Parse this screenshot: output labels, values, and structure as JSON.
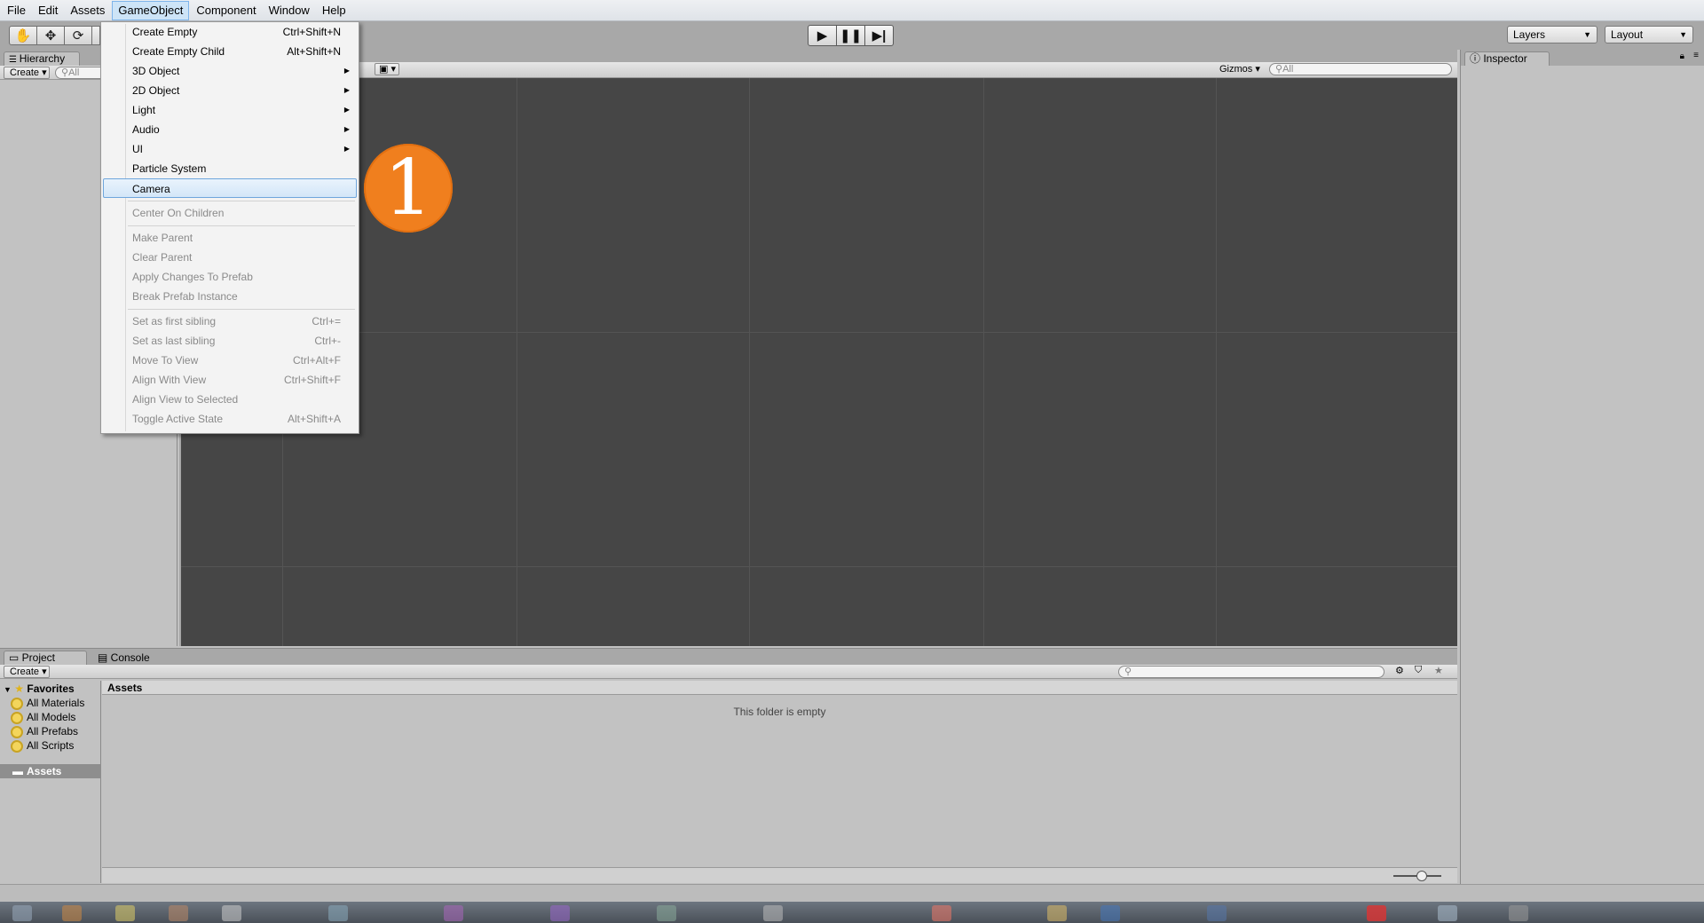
{
  "menubar": {
    "items": [
      "File",
      "Edit",
      "Assets",
      "GameObject",
      "Component",
      "Window",
      "Help"
    ],
    "active": "GameObject"
  },
  "toolbar": {
    "layers_label": "Layers",
    "layout_label": "Layout"
  },
  "hierarchy": {
    "tab_label": "Hierarchy",
    "create_label": "Create",
    "search_placeholder": "All"
  },
  "scene": {
    "gizmos_label": "Gizmos",
    "search_placeholder": "All"
  },
  "inspector": {
    "tab_label": "Inspector"
  },
  "project": {
    "tab_project": "Project",
    "tab_console": "Console",
    "create_label": "Create",
    "favorites_title": "Favorites",
    "favorites": [
      "All Materials",
      "All Models",
      "All Prefabs",
      "All Scripts"
    ],
    "assets_item": "Assets",
    "header": "Assets",
    "empty_message": "This folder is empty"
  },
  "gameobject_menu": {
    "items": [
      {
        "label": "Create Empty",
        "shortcut": "Ctrl+Shift+N"
      },
      {
        "label": "Create Empty Child",
        "shortcut": "Alt+Shift+N"
      },
      {
        "label": "3D Object",
        "submenu": true
      },
      {
        "label": "2D Object",
        "submenu": true
      },
      {
        "label": "Light",
        "submenu": true
      },
      {
        "label": "Audio",
        "submenu": true
      },
      {
        "label": "UI",
        "submenu": true
      },
      {
        "label": "Particle System"
      },
      {
        "label": "Camera",
        "highlighted": true
      },
      {
        "label": "Center On Children",
        "disabled": true
      },
      {
        "label": "Make Parent",
        "disabled": true
      },
      {
        "label": "Clear Parent",
        "disabled": true
      },
      {
        "label": "Apply Changes To Prefab",
        "disabled": true
      },
      {
        "label": "Break Prefab Instance",
        "disabled": true
      },
      {
        "label": "Set as first sibling",
        "shortcut": "Ctrl+=",
        "disabled": true
      },
      {
        "label": "Set as last sibling",
        "shortcut": "Ctrl+-",
        "disabled": true
      },
      {
        "label": "Move To View",
        "shortcut": "Ctrl+Alt+F",
        "disabled": true
      },
      {
        "label": "Align With View",
        "shortcut": "Ctrl+Shift+F",
        "disabled": true
      },
      {
        "label": "Align View to Selected",
        "disabled": true
      },
      {
        "label": "Toggle Active State",
        "shortcut": "Alt+Shift+A",
        "disabled": true
      }
    ]
  },
  "badge": {
    "number": "1",
    "color": "#f07f1e"
  },
  "colors": {
    "scene_background": "#464646",
    "menu_highlight": "#cde4f7",
    "panel_background": "#c2c2c2"
  }
}
